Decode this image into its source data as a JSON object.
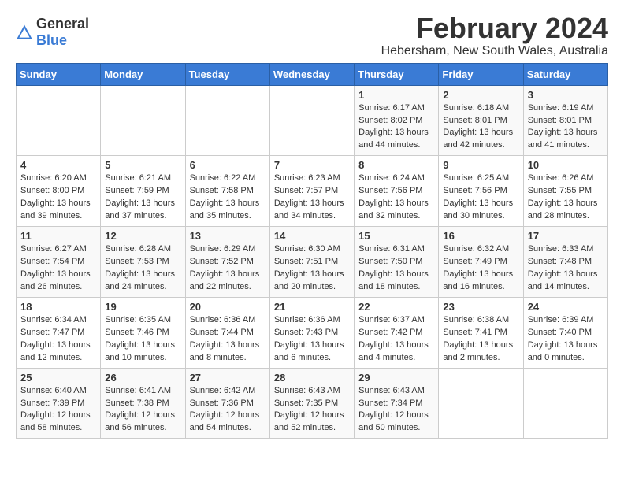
{
  "logo": {
    "text_general": "General",
    "text_blue": "Blue"
  },
  "header": {
    "title": "February 2024",
    "subtitle": "Hebersham, New South Wales, Australia"
  },
  "days_of_week": [
    "Sunday",
    "Monday",
    "Tuesday",
    "Wednesday",
    "Thursday",
    "Friday",
    "Saturday"
  ],
  "weeks": [
    [
      {
        "day": "",
        "content": ""
      },
      {
        "day": "",
        "content": ""
      },
      {
        "day": "",
        "content": ""
      },
      {
        "day": "",
        "content": ""
      },
      {
        "day": "1",
        "content": "Sunrise: 6:17 AM\nSunset: 8:02 PM\nDaylight: 13 hours\nand 44 minutes."
      },
      {
        "day": "2",
        "content": "Sunrise: 6:18 AM\nSunset: 8:01 PM\nDaylight: 13 hours\nand 42 minutes."
      },
      {
        "day": "3",
        "content": "Sunrise: 6:19 AM\nSunset: 8:01 PM\nDaylight: 13 hours\nand 41 minutes."
      }
    ],
    [
      {
        "day": "4",
        "content": "Sunrise: 6:20 AM\nSunset: 8:00 PM\nDaylight: 13 hours\nand 39 minutes."
      },
      {
        "day": "5",
        "content": "Sunrise: 6:21 AM\nSunset: 7:59 PM\nDaylight: 13 hours\nand 37 minutes."
      },
      {
        "day": "6",
        "content": "Sunrise: 6:22 AM\nSunset: 7:58 PM\nDaylight: 13 hours\nand 35 minutes."
      },
      {
        "day": "7",
        "content": "Sunrise: 6:23 AM\nSunset: 7:57 PM\nDaylight: 13 hours\nand 34 minutes."
      },
      {
        "day": "8",
        "content": "Sunrise: 6:24 AM\nSunset: 7:56 PM\nDaylight: 13 hours\nand 32 minutes."
      },
      {
        "day": "9",
        "content": "Sunrise: 6:25 AM\nSunset: 7:56 PM\nDaylight: 13 hours\nand 30 minutes."
      },
      {
        "day": "10",
        "content": "Sunrise: 6:26 AM\nSunset: 7:55 PM\nDaylight: 13 hours\nand 28 minutes."
      }
    ],
    [
      {
        "day": "11",
        "content": "Sunrise: 6:27 AM\nSunset: 7:54 PM\nDaylight: 13 hours\nand 26 minutes."
      },
      {
        "day": "12",
        "content": "Sunrise: 6:28 AM\nSunset: 7:53 PM\nDaylight: 13 hours\nand 24 minutes."
      },
      {
        "day": "13",
        "content": "Sunrise: 6:29 AM\nSunset: 7:52 PM\nDaylight: 13 hours\nand 22 minutes."
      },
      {
        "day": "14",
        "content": "Sunrise: 6:30 AM\nSunset: 7:51 PM\nDaylight: 13 hours\nand 20 minutes."
      },
      {
        "day": "15",
        "content": "Sunrise: 6:31 AM\nSunset: 7:50 PM\nDaylight: 13 hours\nand 18 minutes."
      },
      {
        "day": "16",
        "content": "Sunrise: 6:32 AM\nSunset: 7:49 PM\nDaylight: 13 hours\nand 16 minutes."
      },
      {
        "day": "17",
        "content": "Sunrise: 6:33 AM\nSunset: 7:48 PM\nDaylight: 13 hours\nand 14 minutes."
      }
    ],
    [
      {
        "day": "18",
        "content": "Sunrise: 6:34 AM\nSunset: 7:47 PM\nDaylight: 13 hours\nand 12 minutes."
      },
      {
        "day": "19",
        "content": "Sunrise: 6:35 AM\nSunset: 7:46 PM\nDaylight: 13 hours\nand 10 minutes."
      },
      {
        "day": "20",
        "content": "Sunrise: 6:36 AM\nSunset: 7:44 PM\nDaylight: 13 hours\nand 8 minutes."
      },
      {
        "day": "21",
        "content": "Sunrise: 6:36 AM\nSunset: 7:43 PM\nDaylight: 13 hours\nand 6 minutes."
      },
      {
        "day": "22",
        "content": "Sunrise: 6:37 AM\nSunset: 7:42 PM\nDaylight: 13 hours\nand 4 minutes."
      },
      {
        "day": "23",
        "content": "Sunrise: 6:38 AM\nSunset: 7:41 PM\nDaylight: 13 hours\nand 2 minutes."
      },
      {
        "day": "24",
        "content": "Sunrise: 6:39 AM\nSunset: 7:40 PM\nDaylight: 13 hours\nand 0 minutes."
      }
    ],
    [
      {
        "day": "25",
        "content": "Sunrise: 6:40 AM\nSunset: 7:39 PM\nDaylight: 12 hours\nand 58 minutes."
      },
      {
        "day": "26",
        "content": "Sunrise: 6:41 AM\nSunset: 7:38 PM\nDaylight: 12 hours\nand 56 minutes."
      },
      {
        "day": "27",
        "content": "Sunrise: 6:42 AM\nSunset: 7:36 PM\nDaylight: 12 hours\nand 54 minutes."
      },
      {
        "day": "28",
        "content": "Sunrise: 6:43 AM\nSunset: 7:35 PM\nDaylight: 12 hours\nand 52 minutes."
      },
      {
        "day": "29",
        "content": "Sunrise: 6:43 AM\nSunset: 7:34 PM\nDaylight: 12 hours\nand 50 minutes."
      },
      {
        "day": "",
        "content": ""
      },
      {
        "day": "",
        "content": ""
      }
    ]
  ]
}
